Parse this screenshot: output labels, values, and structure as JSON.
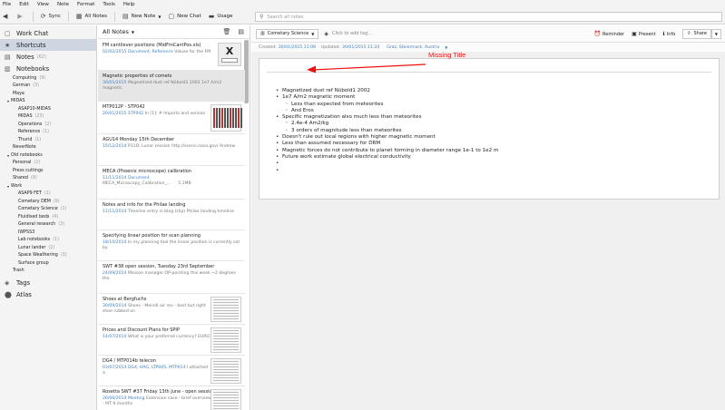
{
  "menu": [
    "File",
    "Edit",
    "View",
    "Note",
    "Format",
    "Tools",
    "Help"
  ],
  "toolbar": {
    "sync": "Sync",
    "all_notes": "All Notes",
    "new_note": "New Note",
    "new_chat": "New Chat",
    "usage": "Usage",
    "search_placeholder": "Search all notes"
  },
  "sidebar": {
    "work_chat": "Work Chat",
    "shortcuts": "Shortcuts",
    "notes": "Notes",
    "notes_count": "(62)",
    "notebooks": "Notebooks",
    "items": [
      {
        "label": "Computing",
        "count": "(9)",
        "indent": 1
      },
      {
        "label": "German",
        "count": "(3)",
        "indent": 1
      },
      {
        "label": "Maya",
        "count": "",
        "indent": 1
      },
      {
        "label": "MIDAS",
        "count": "",
        "indent": 0,
        "group": true
      },
      {
        "label": "ASAP10-MIDAS",
        "count": "",
        "indent": 2
      },
      {
        "label": "MIDAS",
        "count": "(23)",
        "indent": 2
      },
      {
        "label": "Operations",
        "count": "(2)",
        "indent": 2
      },
      {
        "label": "Reference",
        "count": "(1)",
        "indent": 2
      },
      {
        "label": "Thurid",
        "count": "(1)",
        "indent": 2
      },
      {
        "label": "NeverNote",
        "count": "",
        "indent": 1
      },
      {
        "label": "Old notebooks",
        "count": "",
        "indent": 0,
        "group": true
      },
      {
        "label": "Personal",
        "count": "(2)",
        "indent": 1
      },
      {
        "label": "Press cuttings",
        "count": "",
        "indent": 1
      },
      {
        "label": "Shared",
        "count": "(9)",
        "indent": 1
      },
      {
        "label": "Work",
        "count": "",
        "indent": 0,
        "group": true
      },
      {
        "label": "ASAP9 FET",
        "count": "(1)",
        "indent": 2
      },
      {
        "label": "Cometary DEM",
        "count": "(9)",
        "indent": 2
      },
      {
        "label": "Cometary Science",
        "count": "(1)",
        "indent": 2
      },
      {
        "label": "Fluidised beds",
        "count": "(4)",
        "indent": 2
      },
      {
        "label": "General research",
        "count": "(3)",
        "indent": 2
      },
      {
        "label": "IWPSS3",
        "count": "",
        "indent": 2
      },
      {
        "label": "Lab notebooks",
        "count": "(1)",
        "indent": 2
      },
      {
        "label": "Lunar lander",
        "count": "(2)",
        "indent": 2
      },
      {
        "label": "Space Weathering",
        "count": "(3)",
        "indent": 2
      },
      {
        "label": "Surface group",
        "count": "",
        "indent": 2
      },
      {
        "label": "Trash",
        "count": "",
        "indent": 0
      }
    ],
    "tags": "Tags",
    "atlas": "Atlas"
  },
  "notelist": {
    "title": "All Notes",
    "notes": [
      {
        "title": "FM cantilever positions (MidFmCantPos.xls)",
        "date": "02/02/2015",
        "tags": "Document, Reference",
        "snippet": "Values for the FM",
        "snippet2": ""
      },
      {
        "title": "Magnetic properties of comets",
        "date": "30/01/2015",
        "tags": "",
        "snippet": "Magnetized dust ref Nübold1 2002 1e7 A/m2 magnetic",
        "snippet2": ""
      },
      {
        "title": "MTP012P - STP042",
        "date": "20/01/2015",
        "tags": "STP042",
        "snippet": "In [1]: # Imports and version",
        "snippet2": ""
      },
      {
        "title": "AGU14 Monday 15th December",
        "date": "15/12/2014",
        "tags": "",
        "snippet": "P11D: Lunar session http://sservi.nasa.gov/ Andrew",
        "snippet2": ""
      },
      {
        "title": "MECA (Phoenix microscope) calibration",
        "date": "11/11/2014",
        "tags": "Document",
        "snippet": "",
        "snippet2": "MECA_Microscopy_Calibration_...",
        "size": "5.1MB"
      },
      {
        "title": "Notes and info for the Philae landing",
        "date": "11/11/2014",
        "tags": "",
        "snippet": "Timeline entry in blog (clip) Philae landing timeline",
        "snippet2": ""
      },
      {
        "title": "Specifying linear position for scan planning",
        "date": "18/10/2014",
        "tags": "",
        "snippet": "In my planning tool the linear position is currently set by",
        "snippet2": ""
      },
      {
        "title": "SWT #38 open session, Tuesday 23rd September",
        "date": "24/09/2014",
        "tags": "",
        "snippet": "Mission manager OP-pointing this week ~2 degrees the",
        "snippet2": ""
      },
      {
        "title": "Shoes at Bergfuchs",
        "date": "30/09/2014",
        "tags": "",
        "snippet": "Shoes - Meindl air rev - best but right shoe rubbed on",
        "snippet2": ""
      },
      {
        "title": "Prices and Discount Plans for SPIP",
        "date": "14/07/2014",
        "tags": "",
        "snippet": "What is your preferred currency? EURO",
        "snippet2": ""
      },
      {
        "title": "DG4 / MTP014b telecon",
        "date": "03/07/2014",
        "tags": "DG4, HAG, LTP005, MTP014",
        "snippet": "I attached a",
        "snippet2": ""
      },
      {
        "title": "Rosetta SWT #37 Friday 13th June - open session",
        "date": "26/06/2014",
        "tags": "Meeting",
        "snippet": "Extension case - brief overview - MT 9 months",
        "snippet2": ""
      }
    ]
  },
  "editor": {
    "notebook": "Cometary Science",
    "tag_placeholder": "Click to add tag...",
    "reminder": "Reminder",
    "present": "Present",
    "info": "Info",
    "share": "Share",
    "created_label": "Created:",
    "created": "30/01/2015 11:08",
    "updated_label": "Updated:",
    "updated": "30/01/2015 11:24",
    "location": "Graz, Steiermark, Austria",
    "lines": [
      {
        "text": "Magnetized dust ref Nübold1 2002",
        "level": 0
      },
      {
        "text": "1e7 A/m2 magnetic moment",
        "level": 0
      },
      {
        "text": "Less than expected from meteorites",
        "level": 1
      },
      {
        "text": "And Eros",
        "level": 1
      },
      {
        "text": "Specific magnetization also much less than meteorites",
        "level": 0
      },
      {
        "text": "2.4e-4 Am2/kg",
        "level": 1
      },
      {
        "text": "3 orders of magnitude less than meteorites",
        "level": 1
      },
      {
        "text": "Doesn't rule out local regions with higher magnetic moment",
        "level": 0
      },
      {
        "text": "Less than assumed necessary for DRM",
        "level": 0
      },
      {
        "text": "Magnetic forces do not contribute to planet forming in diameter range 1e-1 to 1e2 m",
        "level": 0
      },
      {
        "text": "Future work estimate global electrical conductivity",
        "level": 0
      },
      {
        "text": "",
        "level": 0
      },
      {
        "text": "",
        "level": 0
      }
    ]
  },
  "annotation": {
    "text": "Missing Title",
    "color": "#ee1111"
  }
}
